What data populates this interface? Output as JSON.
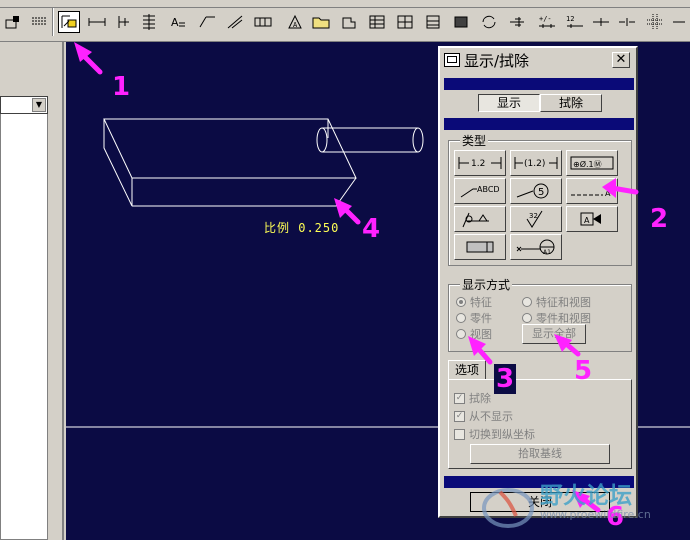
{
  "dialog": {
    "title": "显示/拭除",
    "close_glyph": "✕",
    "tabs": [
      {
        "label": "显示",
        "selected": true
      },
      {
        "label": "拭除",
        "selected": false
      }
    ],
    "type_group_label": "类型",
    "type_buttons": [
      {
        "name": "dimension-button",
        "icon": "dimension-icon",
        "text": "1.2"
      },
      {
        "name": "reference-dimension-button",
        "icon": "ref-dimension-icon",
        "text": "(1.2)"
      },
      {
        "name": "geometric-tolerance-button",
        "icon": "geom-tolerance-icon",
        "text": "⊕Ø.1Ⓜ"
      },
      {
        "name": "note-button",
        "icon": "note-icon",
        "text": "ABCD"
      },
      {
        "name": "balloon-button",
        "icon": "balloon-icon",
        "text": "5"
      },
      {
        "name": "axis-button",
        "icon": "axis-icon",
        "text": "A"
      },
      {
        "name": "symbol-button",
        "icon": "symbol-icon",
        "text": ""
      },
      {
        "name": "surface-finish-button",
        "icon": "surface-finish-icon",
        "text": "32"
      },
      {
        "name": "datum-plane-button",
        "icon": "datum-plane-icon",
        "text": "A"
      },
      {
        "name": "cosmetic-feature-button",
        "icon": "cosmetic-feature-icon",
        "text": ""
      },
      {
        "name": "datum-target-button",
        "icon": "datum-target-icon",
        "text": "A1"
      }
    ],
    "display_mode_label": "显示方式",
    "display_modes": [
      {
        "label": "特征",
        "selected": true
      },
      {
        "label": "特征和视图",
        "selected": false
      },
      {
        "label": "零件",
        "selected": false
      },
      {
        "label": "零件和视图",
        "selected": false
      },
      {
        "label": "视图",
        "selected": false
      }
    ],
    "show_all_label": "显示全部",
    "options_tab_label": "选项",
    "options": [
      {
        "label": "拭除",
        "checked": true
      },
      {
        "label": "从不显示",
        "checked": true
      },
      {
        "label": "切换到纵坐标",
        "checked": false
      }
    ],
    "pick_baseline_label": "拾取基线",
    "close_label": "关闭"
  },
  "canvas": {
    "dimension_text": "比例 0.250"
  },
  "annotations": {
    "markers": [
      "1",
      "2",
      "3",
      "4",
      "5",
      "6"
    ]
  },
  "watermark": {
    "text": "野火论坛",
    "url": "www.proewildfire.cn"
  },
  "colors": {
    "canvas_bg": "#0b0b44",
    "model_lines": "#ffffff",
    "dimension_text": "#ffff55",
    "marker": "#ff22ff",
    "dialog_bar": "#0a0a78"
  }
}
